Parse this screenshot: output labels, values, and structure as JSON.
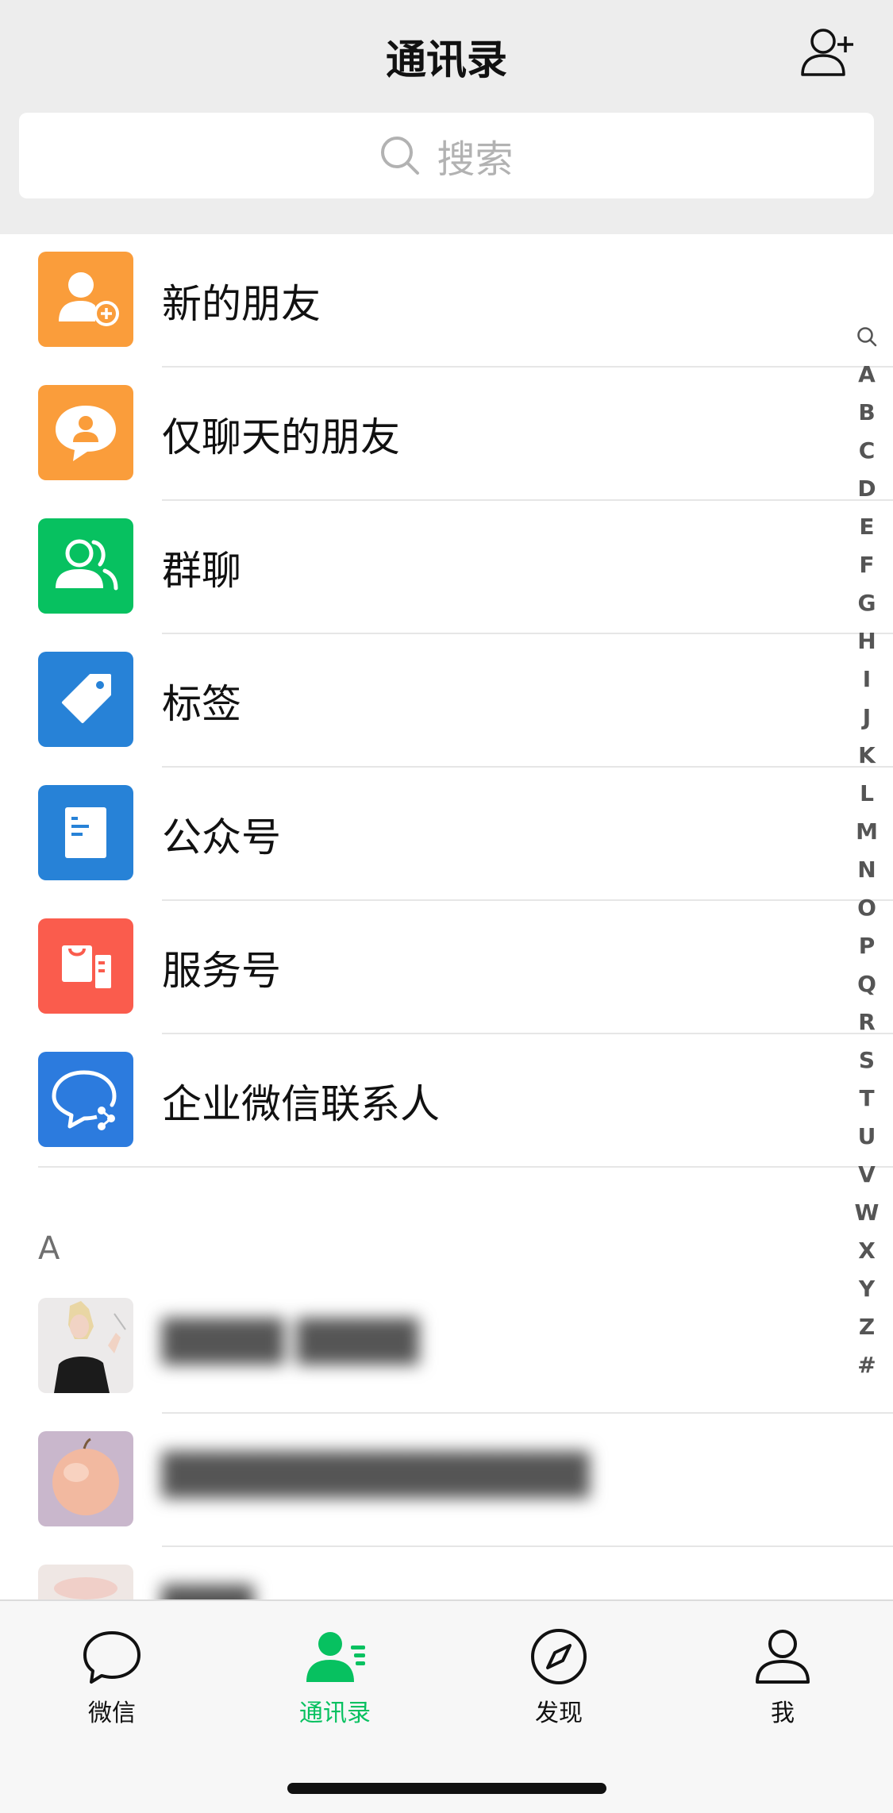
{
  "header": {
    "title": "通讯录",
    "add_icon": "add-contact-icon"
  },
  "search": {
    "placeholder": "搜索",
    "icon": "search-icon"
  },
  "functions": [
    {
      "label": "新的朋友",
      "icon": "new-friend-icon",
      "color": "#fa9d3b"
    },
    {
      "label": "仅聊天的朋友",
      "icon": "chat-only-friend-icon",
      "color": "#fa9d3b"
    },
    {
      "label": "群聊",
      "icon": "group-chat-icon",
      "color": "#07c160"
    },
    {
      "label": "标签",
      "icon": "tag-icon",
      "color": "#2782d7"
    },
    {
      "label": "公众号",
      "icon": "official-account-icon",
      "color": "#2782d7"
    },
    {
      "label": "服务号",
      "icon": "service-account-icon",
      "color": "#fa5c4d"
    },
    {
      "label": "企业微信联系人",
      "icon": "wecom-contact-icon",
      "color": "#2c7bde"
    }
  ],
  "section": {
    "letter": "A"
  },
  "index": [
    "A",
    "B",
    "C",
    "D",
    "E",
    "F",
    "G",
    "H",
    "I",
    "J",
    "K",
    "L",
    "M",
    "N",
    "O",
    "P",
    "Q",
    "R",
    "S",
    "T",
    "U",
    "V",
    "W",
    "X",
    "Y",
    "Z",
    "#"
  ],
  "tabbar": {
    "tabs": [
      {
        "label": "微信",
        "icon": "chat-bubble-icon"
      },
      {
        "label": "通讯录",
        "icon": "contacts-icon",
        "active": true
      },
      {
        "label": "发现",
        "icon": "compass-icon"
      },
      {
        "label": "我",
        "icon": "person-icon"
      }
    ],
    "active_color": "#07c160"
  }
}
